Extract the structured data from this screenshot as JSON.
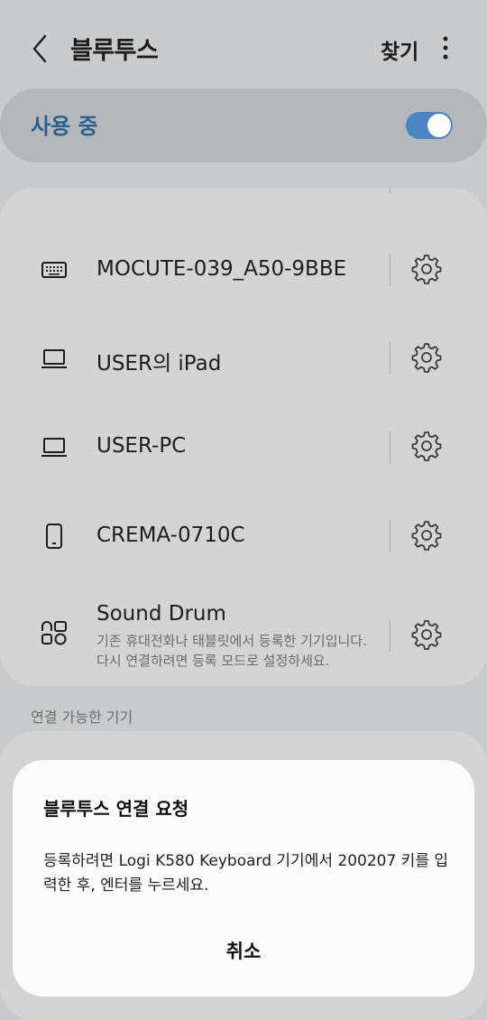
{
  "header": {
    "title": "블루투스",
    "find_label": "찾기",
    "back_icon": "chevron-left-icon",
    "more_icon": "more-vert-icon"
  },
  "toggle": {
    "label": "사용 중",
    "on": true,
    "accent_color": "#4b86c2",
    "label_color": "#2d5f8d"
  },
  "paired_devices": [
    {
      "name": "MOCUTE-039_A50-9BBE",
      "icon": "keyboard-icon"
    },
    {
      "name": "USER의 iPad",
      "icon": "laptop-icon"
    },
    {
      "name": "USER-PC",
      "icon": "laptop-icon"
    },
    {
      "name": "CREMA-0710C",
      "icon": "phone-icon"
    },
    {
      "name": "Sound Drum",
      "icon": "grid-device-icon",
      "sub1": "기존 휴대전화나 태블릿에서 등록한 기기입니다.",
      "sub2": "다시 연결하려면 등록 모드로 설정하세요."
    }
  ],
  "available_section": {
    "label": "연결 가능한 기기"
  },
  "dialog": {
    "title": "블루투스 연결 요청",
    "message": "등록하려면 Logi K580 Keyboard 기기에서 200207 키를 입력한 후, 엔터를 누르세요.",
    "cancel_label": "취소"
  }
}
